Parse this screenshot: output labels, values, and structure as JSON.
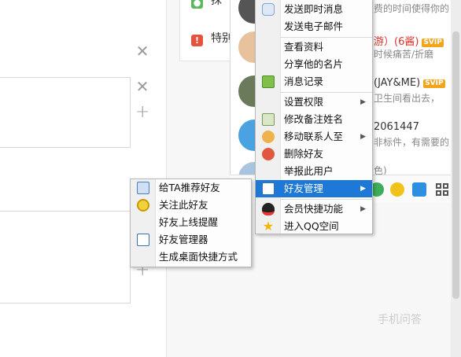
{
  "feed": {
    "item1": {
      "label": "抹",
      "icon_color": "#5cb85c"
    },
    "item2": {
      "label": "特别",
      "icon_color": "#e5533c",
      "icon_text": "!"
    }
  },
  "contacts": [
    {
      "name": "",
      "signature": "费的时间使得你的"
    },
    {
      "name": "游）(6酱)",
      "signature": "时候痛苦/折磨"
    },
    {
      "name": "(JAY&ME)",
      "signature": "卫生间看出去，"
    },
    {
      "name": "2061447",
      "signature": "非标件，有需要的"
    },
    {
      "name": "",
      "signature": "色)"
    }
  ],
  "badges": {
    "svip": "SVIP"
  },
  "main_menu": {
    "items": [
      {
        "label": "发送即时消息",
        "icon": "chat-bubble-icon"
      },
      {
        "label": "发送电子邮件",
        "icon": ""
      },
      {
        "label": "查看资料",
        "icon": ""
      },
      {
        "label": "分享他的名片",
        "icon": ""
      },
      {
        "label": "消息记录",
        "icon": "message-log-icon"
      },
      {
        "label": "设置权限",
        "icon": ""
      },
      {
        "label": "修改备注姓名",
        "icon": "edit-remark-icon"
      },
      {
        "label": "移动联系人至",
        "icon": "move-contact-icon"
      },
      {
        "label": "删除好友",
        "icon": "delete-friend-icon"
      },
      {
        "label": "举报此用户",
        "icon": ""
      },
      {
        "label": "好友管理",
        "icon": "friend-manage-icon"
      },
      {
        "label": "会员快捷功能",
        "icon": "qq-penguin-icon"
      },
      {
        "label": "进入QQ空间",
        "icon": "qzone-star-icon"
      }
    ]
  },
  "sub_menu": {
    "items": [
      {
        "label": "给TA推荐好友",
        "icon": "recommend-friend-icon"
      },
      {
        "label": "关注此好友",
        "icon": "follow-friend-icon"
      },
      {
        "label": "好友上线提醒",
        "icon": ""
      },
      {
        "label": "好友管理器",
        "icon": "friend-manager-icon"
      },
      {
        "label": "生成桌面快捷方式",
        "icon": ""
      }
    ]
  },
  "watermark": "手机问答",
  "colors": {
    "highlight": "#1e78d6",
    "svip": "#f2a41b"
  }
}
